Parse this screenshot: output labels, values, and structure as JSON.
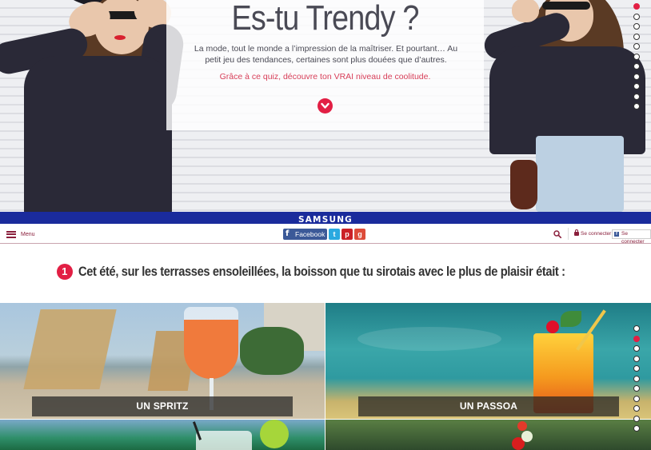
{
  "hero": {
    "title": "Es-tu Trendy ?",
    "intro": "La mode, tout le monde a l’impression de la maîtriser. Et pourtant… Au petit jeu des tendances, certaines sont plus douées que d’autres.",
    "subtitle": "Grâce à ce quiz, découvre ton VRAI niveau de coolitude.",
    "scroll_icon": "chevron-down-icon",
    "dots_count": 11,
    "active_dot": 0
  },
  "brand": {
    "name": "SAMSUNG",
    "bar_color": "#1a2b9c"
  },
  "nav": {
    "menu_label": "Menu",
    "facebook_label": "Facebook",
    "share_icons": [
      "facebook-icon",
      "twitter-icon",
      "pinterest-icon",
      "google-plus-icon"
    ],
    "search_icon": "search-icon",
    "login_label": "Se connecter",
    "fb_login_label": "Se connecter"
  },
  "question": {
    "number": "1",
    "text": "Cet été, sur les terrasses ensoleillées, la boisson que tu sirotais avec le plus de plaisir était :",
    "dots_count": 11,
    "active_dot": 1
  },
  "answers": [
    {
      "label": "UN SPRITZ"
    },
    {
      "label": "UN PASSOA"
    },
    {
      "label": ""
    },
    {
      "label": ""
    }
  ],
  "colors": {
    "accent": "#e21f44",
    "brand_nav": "#8a1f3c",
    "text": "#4a4a55"
  }
}
